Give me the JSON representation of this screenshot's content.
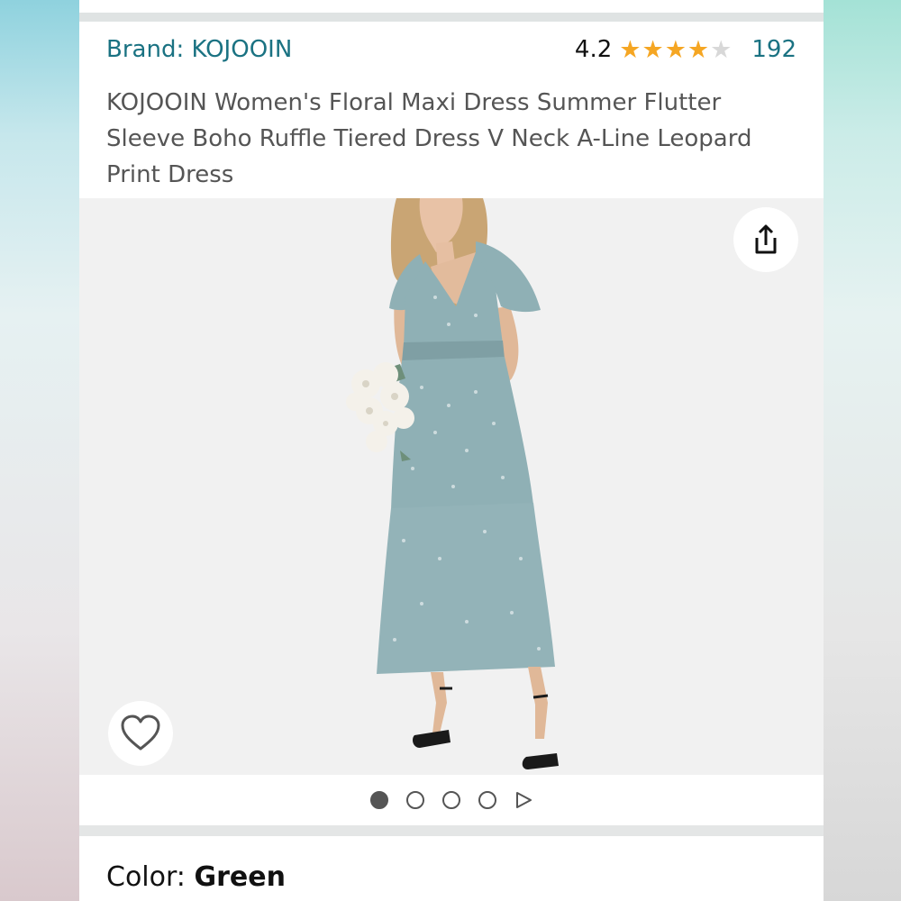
{
  "header": {
    "brand": "Brand: KOJOOIN",
    "rating_value": "4.2",
    "rating_stars": 4.2,
    "rating_count": "192",
    "title": "KOJOOIN Women's Floral Maxi Dress Summer Flutter Sleeve Boho Ruffle Tiered Dress V Neck A-Line Leopard Print Dress"
  },
  "gallery": {
    "image_icon": "product-photo-dress",
    "share_icon": "share-icon",
    "wishlist_icon": "heart-icon",
    "dot_count": 4,
    "active_dot": 0,
    "next_icon": "play-arrow-icon"
  },
  "variant": {
    "label": "Color: ",
    "value": "Green"
  },
  "colors": {
    "link": "#1a7282",
    "star": "#f5a623",
    "dress": "#8fb0b5"
  }
}
